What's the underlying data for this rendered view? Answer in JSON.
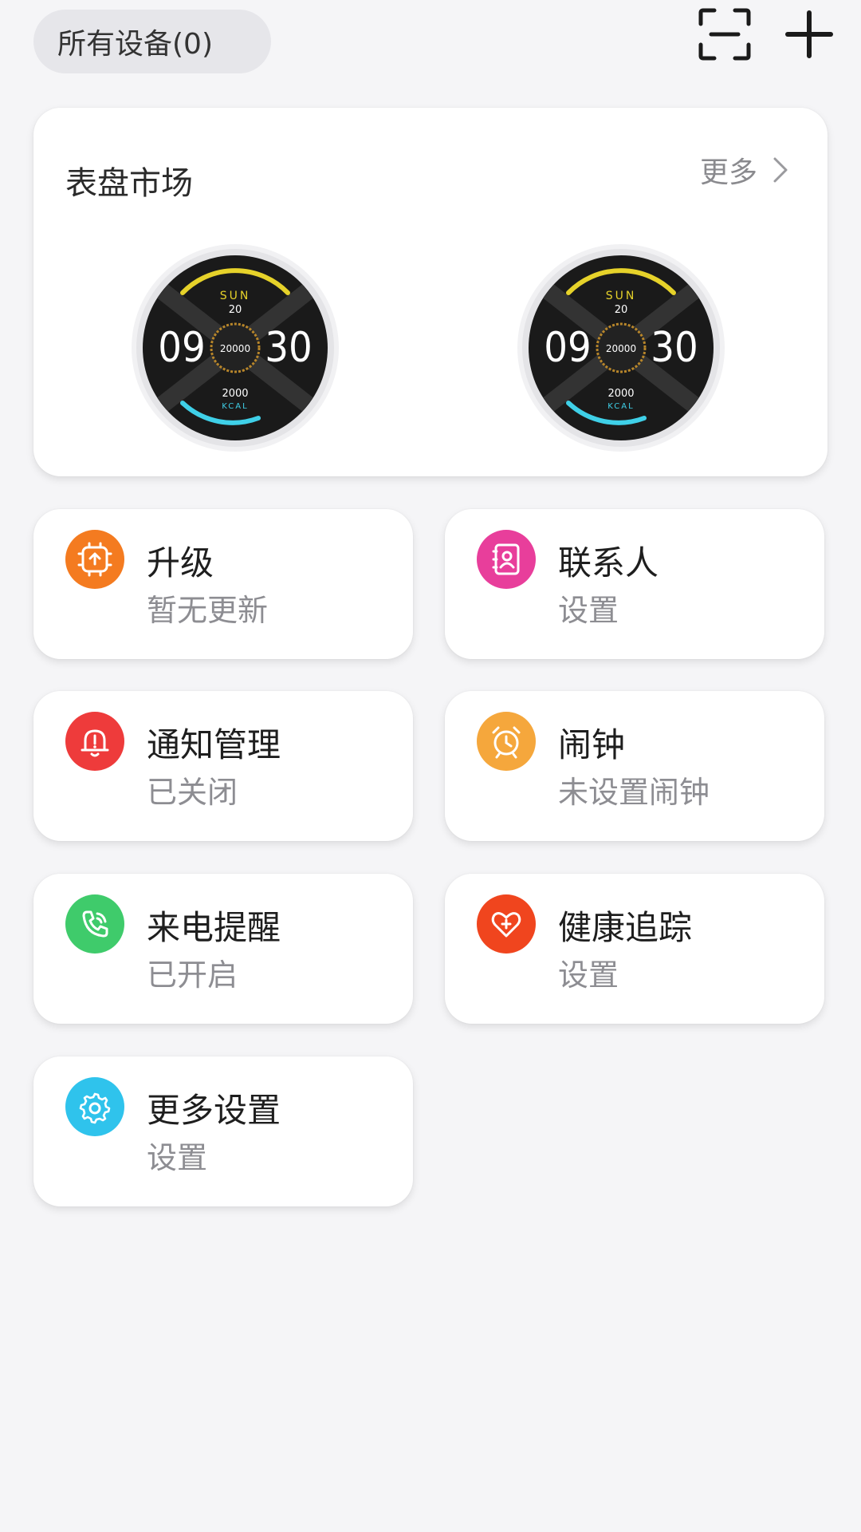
{
  "topbar": {
    "device_selector": "所有设备(0)",
    "scan_icon": "scan-icon",
    "add_icon": "plus-icon"
  },
  "market": {
    "title": "表盘市场",
    "more": "更多",
    "faces": [
      {
        "day": "SUN",
        "date": "20",
        "hour": "09",
        "minute": "30",
        "steps": "20000",
        "kcal": "2000",
        "kcal_label": "KCAL"
      },
      {
        "day": "SUN",
        "date": "20",
        "hour": "09",
        "minute": "30",
        "steps": "20000",
        "kcal": "2000",
        "kcal_label": "KCAL"
      }
    ]
  },
  "tiles": [
    {
      "title": "升级",
      "sub": "暂无更新",
      "icon": "upgrade-icon",
      "color": "#F47B20"
    },
    {
      "title": "联系人",
      "sub": "设置",
      "icon": "contacts-icon",
      "color": "#E83E9B"
    },
    {
      "title": "通知管理",
      "sub": "已关闭",
      "icon": "bell-icon",
      "color": "#EE3B3B"
    },
    {
      "title": "闹钟",
      "sub": "未设置闹钟",
      "icon": "alarm-clock-icon",
      "color": "#F5A73C"
    },
    {
      "title": "来电提醒",
      "sub": "已开启",
      "icon": "phone-icon",
      "color": "#3FCB6B"
    },
    {
      "title": "健康追踪",
      "sub": "设置",
      "icon": "heart-plus-icon",
      "color": "#F0451E"
    },
    {
      "title": "更多设置",
      "sub": "设置",
      "icon": "gear-icon",
      "color": "#2FC3EC"
    }
  ]
}
